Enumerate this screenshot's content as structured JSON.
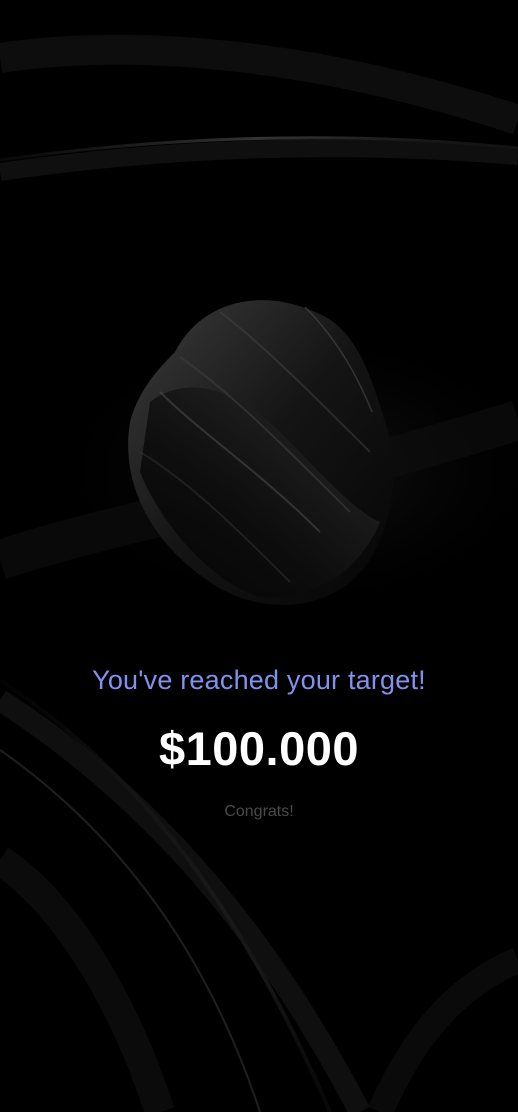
{
  "screen": {
    "headline": "You've reached your target!",
    "amount": "$100.000",
    "subtext": "Congrats!"
  },
  "theme": {
    "background": "#000000",
    "accent": "#8391ee",
    "amount_color": "#ffffff",
    "subtext_color": "#4a4a4a"
  },
  "graphics": {
    "background_art": "dark-silk-waves",
    "hero_art": "twisted-black-sculpture"
  }
}
